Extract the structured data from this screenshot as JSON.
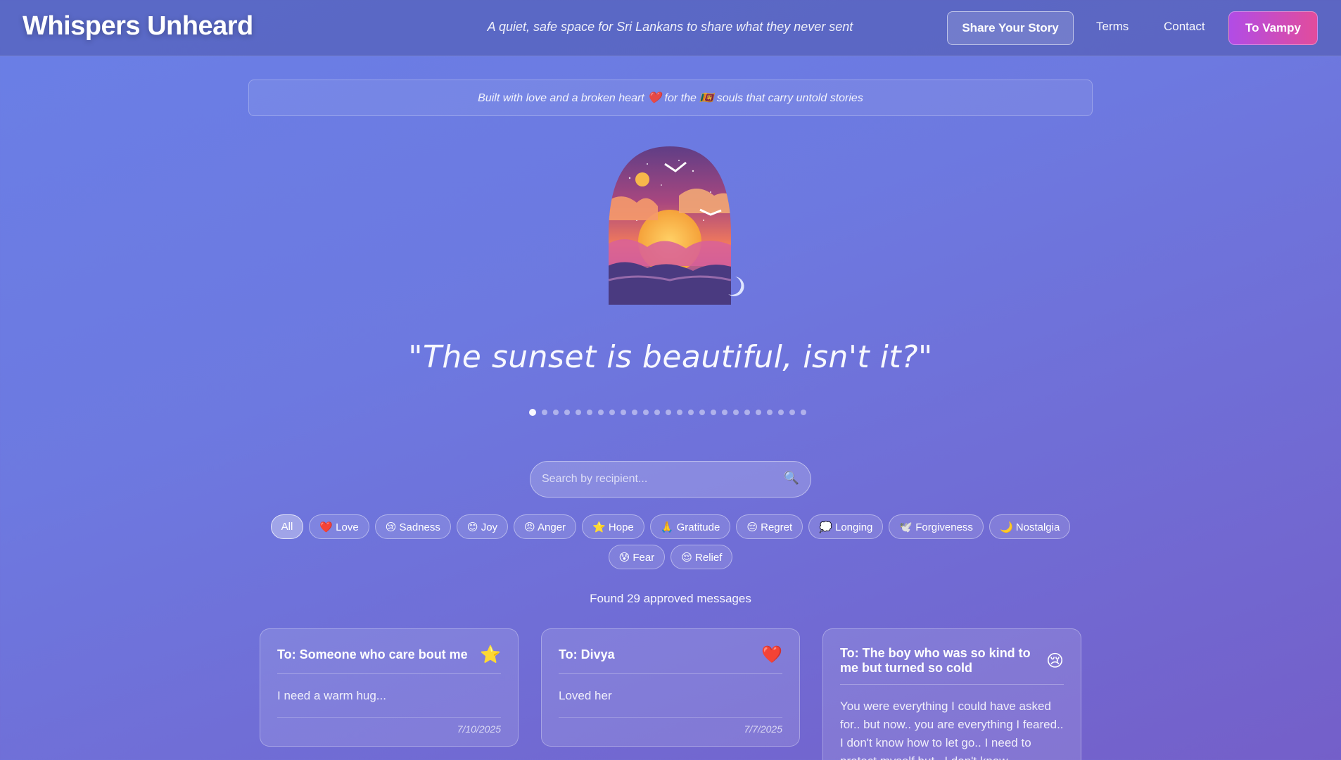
{
  "header": {
    "brand": "Whispers Unheard",
    "tagline": "A quiet, safe space for Sri Lankans to share what they never sent",
    "share_label": "Share Your Story",
    "terms_label": "Terms",
    "contact_label": "Contact",
    "vampy_label": "To Vampy"
  },
  "banner": {
    "text": "Built with love and a broken heart ❤️ for the 🇱🇰 souls that carry untold stories"
  },
  "hero": {
    "quote": "\"The sunset is beautiful, isn't it?\"",
    "slide_count": 25,
    "active_slide": 1
  },
  "search": {
    "placeholder": "Search by recipient...",
    "icon": "search-icon"
  },
  "filters": {
    "row1": [
      "All",
      "❤️ Love",
      "😢 Sadness",
      "😊 Joy",
      "😠 Anger",
      "⭐ Hope",
      "🙏 Gratitude",
      "😔 Regret",
      "💭 Longing",
      "🕊️ Forgiveness",
      "🌙 Nostalgia"
    ],
    "row2": [
      "😰 Fear",
      "😌 Relief"
    ],
    "selected": "All"
  },
  "results": {
    "found_text": "Found 29 approved messages"
  },
  "cards": [
    {
      "to": "To: Someone who care bout me",
      "emoji": "⭐",
      "body": "I need a warm hug...",
      "date": "7/10/2025"
    },
    {
      "to": "To: Divya",
      "emoji": "❤️",
      "body": "Loved her",
      "date": "7/7/2025"
    },
    {
      "to": "To: The boy who was so kind to me but turned so cold",
      "emoji": "😢",
      "body": "You were everything I could have asked for.. but now.. you are everything I feared.. I don't know how to let go.. I need to protect myself but.. I don't know",
      "date": ""
    }
  ],
  "colors": {
    "background_start": "#6a7fe6",
    "background_end": "#745fc9",
    "vampy_start": "#b14ce6",
    "vampy_end": "#e24c9c"
  }
}
